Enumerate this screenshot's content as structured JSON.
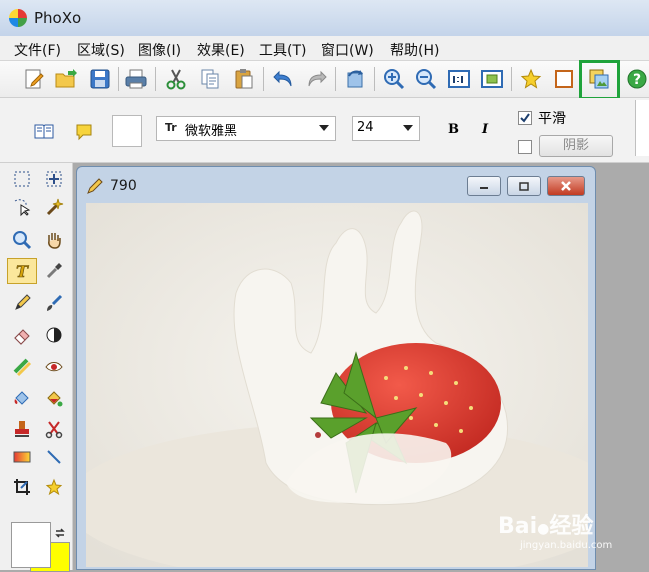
{
  "app": {
    "title": "PhoXo"
  },
  "menu": {
    "items": [
      "文件(F)",
      "区域(S)",
      "图像(I)",
      "效果(E)",
      "工具(T)",
      "窗口(W)",
      "帮助(H)"
    ]
  },
  "text_toolbar": {
    "font": "微软雅黑",
    "size": "24",
    "bold": "B",
    "italic": "I",
    "smooth_label": "平滑",
    "smooth_checked": true,
    "shadow_label": "阴影",
    "shadow_checked": false
  },
  "document": {
    "title": "790"
  },
  "watermark": {
    "brand": "Bai",
    "brand_suffix": "经验",
    "url": "jingyan.baidu.com"
  },
  "colors": {
    "foreground": "#ffffff",
    "background": "#ffff00",
    "highlight": "#1fa33b"
  }
}
